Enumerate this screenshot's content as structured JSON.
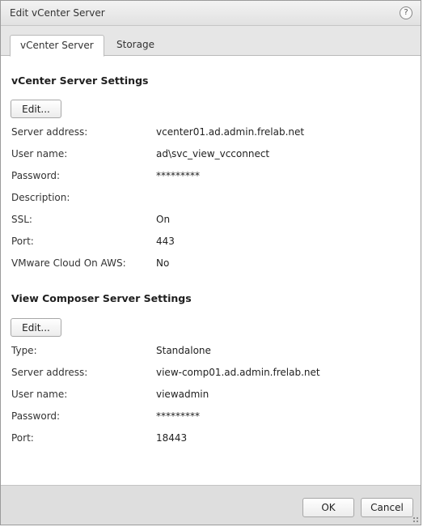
{
  "dialog": {
    "title": "Edit vCenter Server",
    "help_icon": "?"
  },
  "tabs": [
    {
      "label": "vCenter Server",
      "active": true
    },
    {
      "label": "Storage",
      "active": false
    }
  ],
  "vcenter": {
    "section_title": "vCenter Server Settings",
    "edit_label": "Edit...",
    "rows": [
      {
        "label": "Server address:",
        "value": "vcenter01.ad.admin.frelab.net"
      },
      {
        "label": "User name:",
        "value": "ad\\svc_view_vcconnect"
      },
      {
        "label": "Password:",
        "value": "*********"
      },
      {
        "label": "Description:",
        "value": ""
      },
      {
        "label": "SSL:",
        "value": "On"
      },
      {
        "label": "Port:",
        "value": "443"
      },
      {
        "label": "VMware Cloud On AWS:",
        "value": "No"
      }
    ]
  },
  "composer": {
    "section_title": "View Composer Server Settings",
    "edit_label": "Edit...",
    "rows": [
      {
        "label": "Type:",
        "value": "Standalone"
      },
      {
        "label": "Server address:",
        "value": "view-comp01.ad.admin.frelab.net"
      },
      {
        "label": "User name:",
        "value": "viewadmin"
      },
      {
        "label": "Password:",
        "value": "*********"
      },
      {
        "label": "Port:",
        "value": "18443"
      }
    ]
  },
  "footer": {
    "ok_label": "OK",
    "cancel_label": "Cancel"
  },
  "colors": {
    "titlebar": "#e8e8e8",
    "footer": "#dedede",
    "border": "#9b9b9b"
  }
}
